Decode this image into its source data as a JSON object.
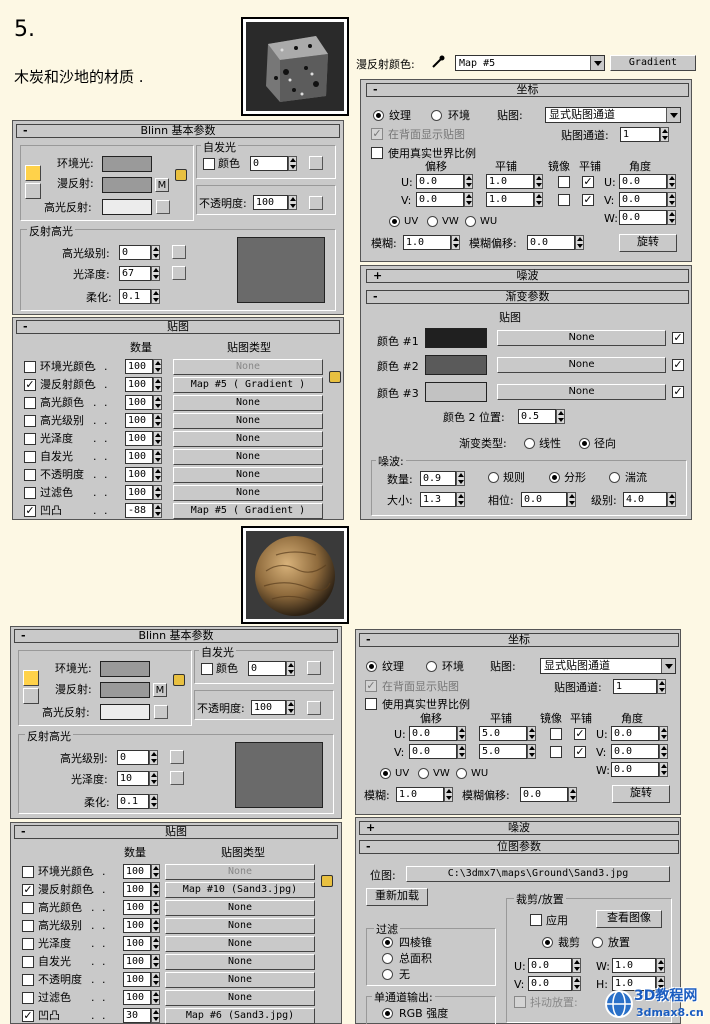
{
  "step": "5.",
  "heading": "木炭和沙地的材质 .",
  "watermark": {
    "logo": "3D教程网",
    "url": "3dmax8.cn"
  },
  "sec1": {
    "diffuse_label": "漫反射颜色:",
    "map_name": "Map #5",
    "map_type": "Gradient",
    "blinn": {
      "title": "Blinn 基本参数",
      "self_illum": "自发光",
      "color_label": "颜色",
      "color_val": "0",
      "ambient": "环境光:",
      "diffuse": "漫反射:",
      "specular": "高光反射:",
      "m": "M",
      "opacity_label": "不透明度:",
      "opacity_val": "100",
      "spec_hl": "反射高光",
      "spec_level": "高光级别:",
      "spec_level_val": "0",
      "gloss": "光泽度:",
      "gloss_val": "67",
      "soften": "柔化:",
      "soften_val": "0.1"
    },
    "maps": {
      "title": "贴图",
      "col_amount": "数量",
      "col_type": "贴图类型",
      "rows": [
        {
          "checked": false,
          "label": "环境光颜色",
          "amount": "100",
          "type": "None"
        },
        {
          "checked": true,
          "label": "漫反射颜色",
          "amount": "100",
          "type": "Map #5   ( Gradient )"
        },
        {
          "checked": false,
          "label": "高光颜色",
          "amount": "100",
          "type": "None"
        },
        {
          "checked": false,
          "label": "高光级别",
          "amount": "100",
          "type": "None"
        },
        {
          "checked": false,
          "label": "光泽度",
          "amount": "100",
          "type": "None"
        },
        {
          "checked": false,
          "label": "自发光",
          "amount": "100",
          "type": "None"
        },
        {
          "checked": false,
          "label": "不透明度",
          "amount": "100",
          "type": "None"
        },
        {
          "checked": false,
          "label": "过滤色",
          "amount": "100",
          "type": "None"
        },
        {
          "checked": true,
          "label": "凹凸",
          "amount": "-88",
          "type": "Map #5   ( Gradient )"
        }
      ]
    },
    "coords": {
      "title": "坐标",
      "texture": "纹理",
      "env": "环境",
      "mapping": "贴图:",
      "mapping_val": "显式贴图通道",
      "show_back": "在背面显示贴图",
      "channel": "贴图通道:",
      "channel_val": "1",
      "real_world": "使用真实世界比例",
      "offset": "偏移",
      "tiling": "平铺",
      "mirror": "镜像",
      "tile": "平铺",
      "angle": "角度",
      "u": "U:",
      "v": "V:",
      "w": "W:",
      "u_off": "0.0",
      "v_off": "0.0",
      "u_tile": "1.0",
      "v_tile": "1.0",
      "u_ang": "0.0",
      "v_ang": "0.0",
      "w_ang": "0.0",
      "uv": "UV",
      "vw": "VW",
      "wu": "WU",
      "blur": "模糊:",
      "blur_val": "1.0",
      "blur_off": "模糊偏移:",
      "blur_off_val": "0.0",
      "rotate": "旋转"
    },
    "noise_title": "噪波",
    "gradient": {
      "title": "渐变参数",
      "maps": "贴图",
      "c1": "颜色 #1",
      "c2": "颜色 #2",
      "c3": "颜色 #3",
      "none": "None",
      "pos_label": "颜色 2 位置:",
      "pos_val": "0.5",
      "type_label": "渐变类型:",
      "linear": "线性",
      "radial": "径向",
      "noise": "噪波:",
      "amount": "数量:",
      "amount_val": "0.9",
      "regular": "规则",
      "fractal": "分形",
      "turb": "湍流",
      "size": "大小:",
      "size_val": "1.3",
      "phase": "相位:",
      "phase_val": "0.0",
      "levels": "级别:",
      "levels_val": "4.0"
    }
  },
  "sec2": {
    "blinn": {
      "title": "Blinn 基本参数",
      "self_illum": "自发光",
      "color_label": "颜色",
      "color_val": "0",
      "ambient": "环境光:",
      "diffuse": "漫反射:",
      "specular": "高光反射:",
      "m": "M",
      "opacity_label": "不透明度:",
      "opacity_val": "100",
      "spec_hl": "反射高光",
      "spec_level": "高光级别:",
      "spec_level_val": "0",
      "gloss": "光泽度:",
      "gloss_val": "10",
      "soften": "柔化:",
      "soften_val": "0.1"
    },
    "maps": {
      "title": "贴图",
      "col_amount": "数量",
      "col_type": "贴图类型",
      "rows": [
        {
          "checked": false,
          "label": "环境光颜色",
          "amount": "100",
          "type": "None"
        },
        {
          "checked": true,
          "label": "漫反射颜色",
          "amount": "100",
          "type": "Map #10  (Sand3.jpg)"
        },
        {
          "checked": false,
          "label": "高光颜色",
          "amount": "100",
          "type": "None"
        },
        {
          "checked": false,
          "label": "高光级别",
          "amount": "100",
          "type": "None"
        },
        {
          "checked": false,
          "label": "光泽度",
          "amount": "100",
          "type": "None"
        },
        {
          "checked": false,
          "label": "自发光",
          "amount": "100",
          "type": "None"
        },
        {
          "checked": false,
          "label": "不透明度",
          "amount": "100",
          "type": "None"
        },
        {
          "checked": false,
          "label": "过滤色",
          "amount": "100",
          "type": "None"
        },
        {
          "checked": true,
          "label": "凹凸",
          "amount": "30",
          "type": "Map #6  (Sand3.jpg)"
        }
      ]
    },
    "coords": {
      "title": "坐标",
      "texture": "纹理",
      "env": "环境",
      "mapping": "贴图:",
      "mapping_val": "显式贴图通道",
      "show_back": "在背面显示贴图",
      "channel": "贴图通道:",
      "channel_val": "1",
      "real_world": "使用真实世界比例",
      "offset": "偏移",
      "tiling": "平铺",
      "mirror": "镜像",
      "tile": "平铺",
      "angle": "角度",
      "u": "U:",
      "v": "V:",
      "w": "W:",
      "u_off": "0.0",
      "v_off": "0.0",
      "u_tile": "5.0",
      "v_tile": "5.0",
      "u_ang": "0.0",
      "v_ang": "0.0",
      "w_ang": "0.0",
      "uv": "UV",
      "vw": "VW",
      "wu": "WU",
      "blur": "模糊:",
      "blur_val": "1.0",
      "blur_off": "模糊偏移:",
      "blur_off_val": "0.0",
      "rotate": "旋转"
    },
    "noise_title": "噪波",
    "bitmap": {
      "title": "位图参数",
      "bitmap": "位图:",
      "path": "C:\\3dmx7\\maps\\Ground\\Sand3.jpg",
      "reload": "重新加载",
      "crop_place": "裁剪/放置",
      "apply": "应用",
      "view": "查看图像",
      "crop": "裁剪",
      "place": "放置",
      "filter": "过滤",
      "pyramid": "四棱锥",
      "summed": "总面积",
      "none": "无",
      "u": "U:",
      "v": "V:",
      "w": "W:",
      "h": "H:",
      "u_val": "0.0",
      "v_val": "0.0",
      "w_val": "1.0",
      "h_val": "1.0",
      "jitter": "抖动放置:",
      "mono": "单通道输出:",
      "rgb": "RGB 强度"
    }
  }
}
